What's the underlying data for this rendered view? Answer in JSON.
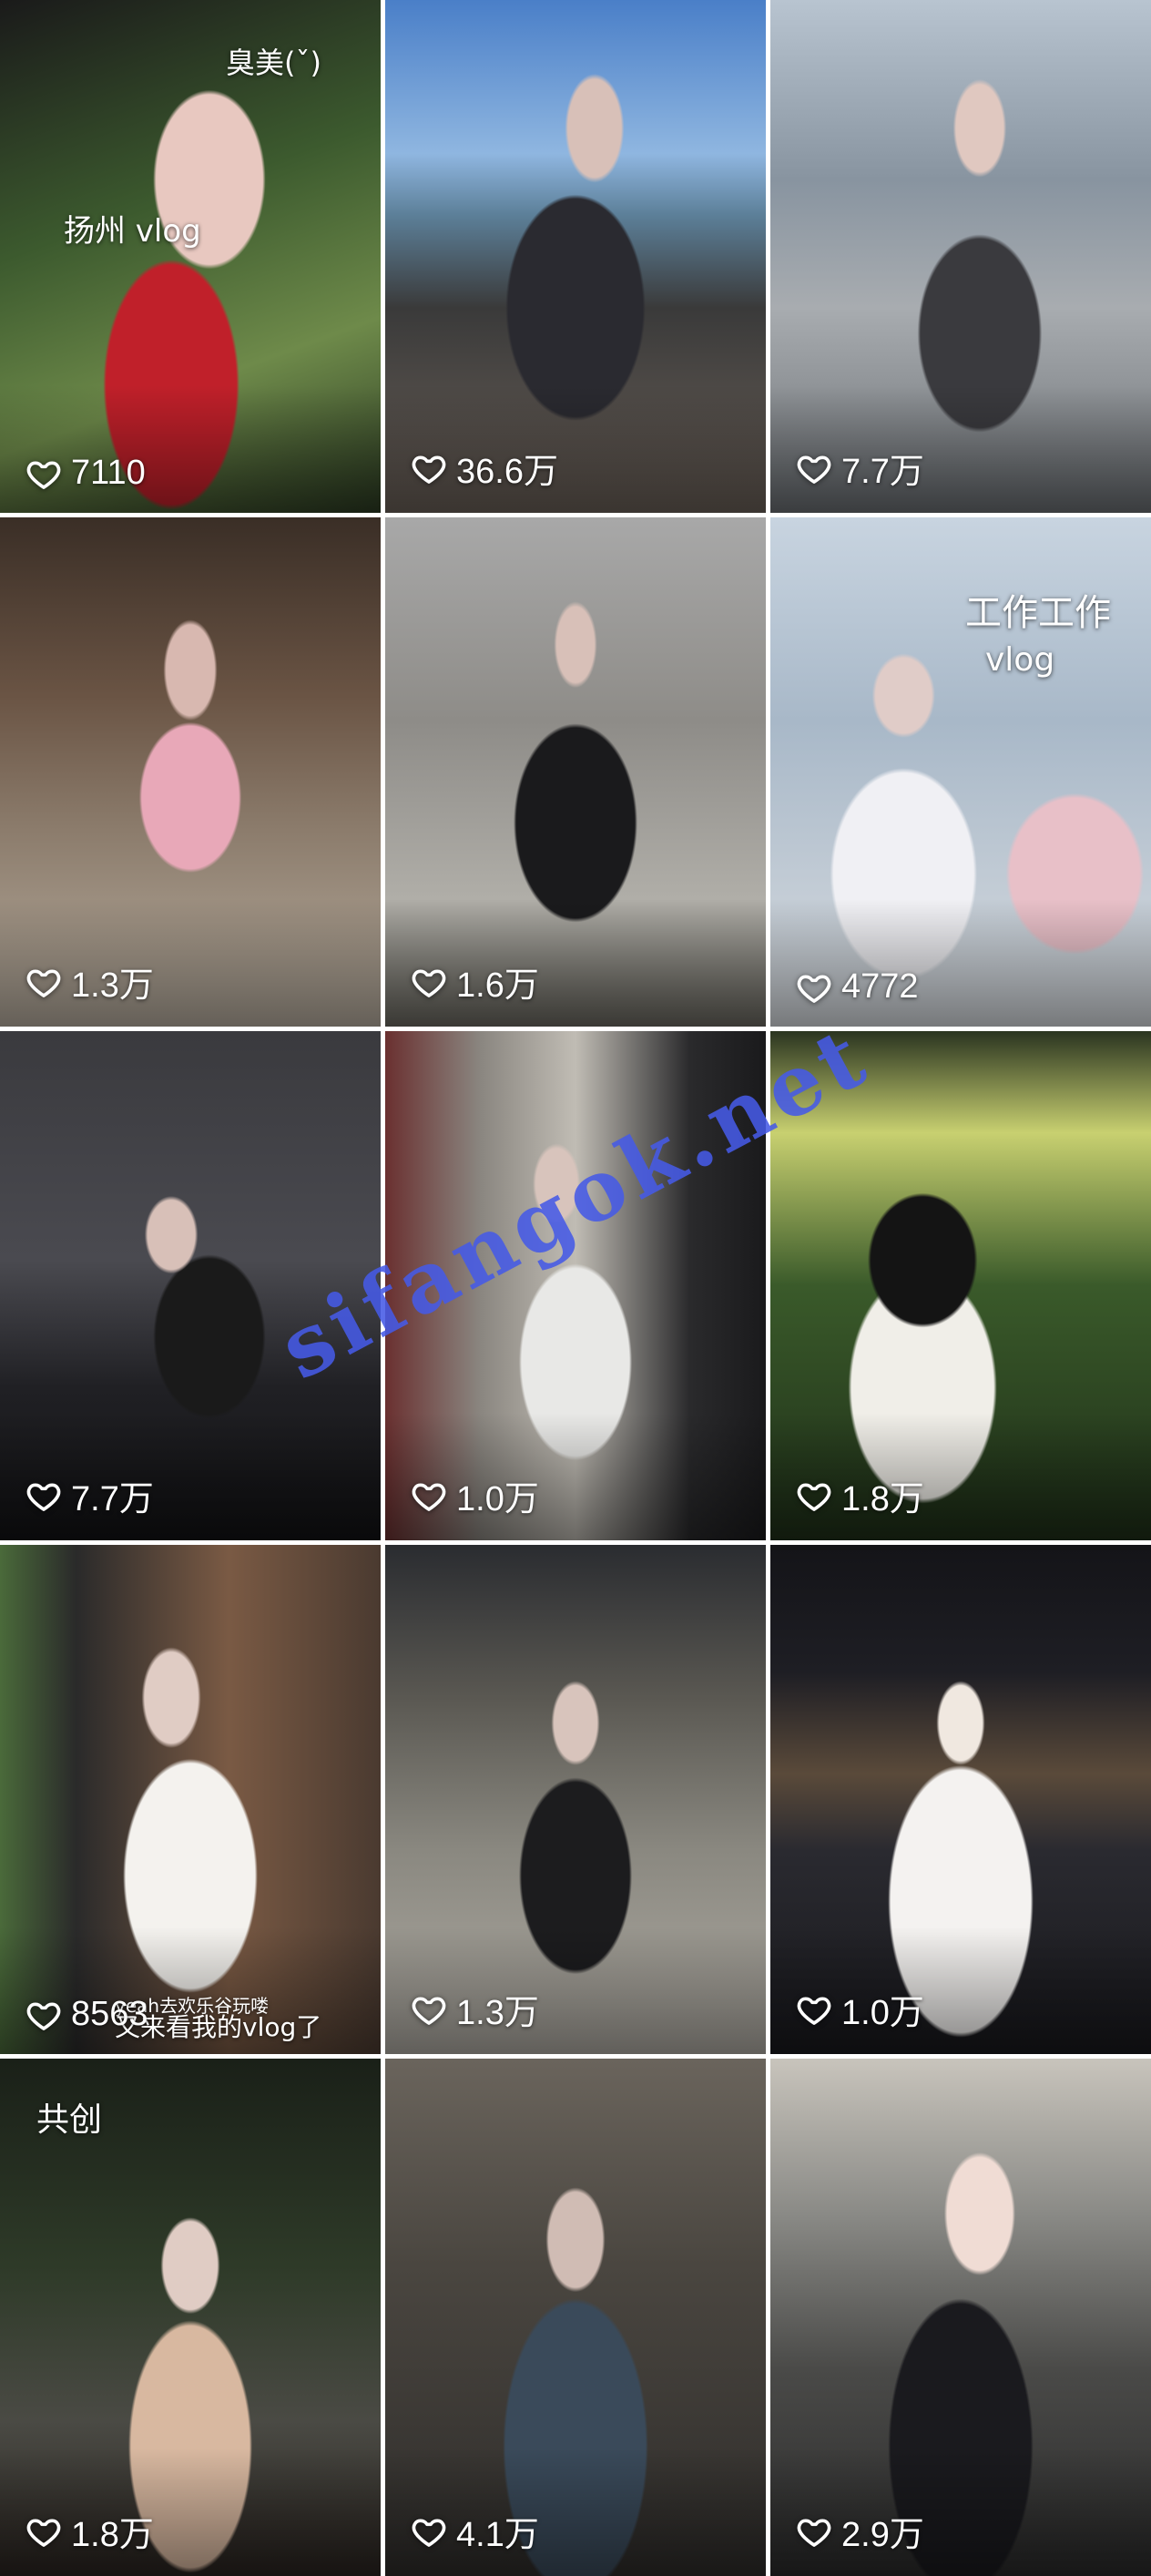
{
  "colors": {
    "like_text": "#ffffff",
    "watermark": "#4a5ae6",
    "background": "#ffffff"
  },
  "icons": {
    "like": "heart-outline-icon"
  },
  "watermark": "sifangok.net",
  "videos": [
    {
      "likes": "7110",
      "overlays": [
        "臭美(ˇ)",
        "扬州 vlog"
      ],
      "badge": ""
    },
    {
      "likes": "36.6万",
      "overlays": [],
      "badge": ""
    },
    {
      "likes": "7.7万",
      "overlays": [],
      "badge": ""
    },
    {
      "likes": "1.3万",
      "overlays": [],
      "badge": ""
    },
    {
      "likes": "1.6万",
      "overlays": [],
      "badge": ""
    },
    {
      "likes": "4772",
      "overlays": [
        "工作工作",
        "vlog"
      ],
      "badge": ""
    },
    {
      "likes": "7.7万",
      "overlays": [],
      "badge": ""
    },
    {
      "likes": "1.0万",
      "overlays": [],
      "badge": ""
    },
    {
      "likes": "1.8万",
      "overlays": [],
      "badge": ""
    },
    {
      "likes": "8563",
      "overlays": [
        "yeah去欢乐谷玩喽",
        "又来看我的vlog了"
      ],
      "badge": ""
    },
    {
      "likes": "1.3万",
      "overlays": [],
      "badge": ""
    },
    {
      "likes": "1.0万",
      "overlays": [],
      "badge": ""
    },
    {
      "likes": "1.8万",
      "overlays": [],
      "badge": "共创"
    },
    {
      "likes": "4.1万",
      "overlays": [],
      "badge": ""
    },
    {
      "likes": "2.9万",
      "overlays": [],
      "badge": ""
    }
  ]
}
